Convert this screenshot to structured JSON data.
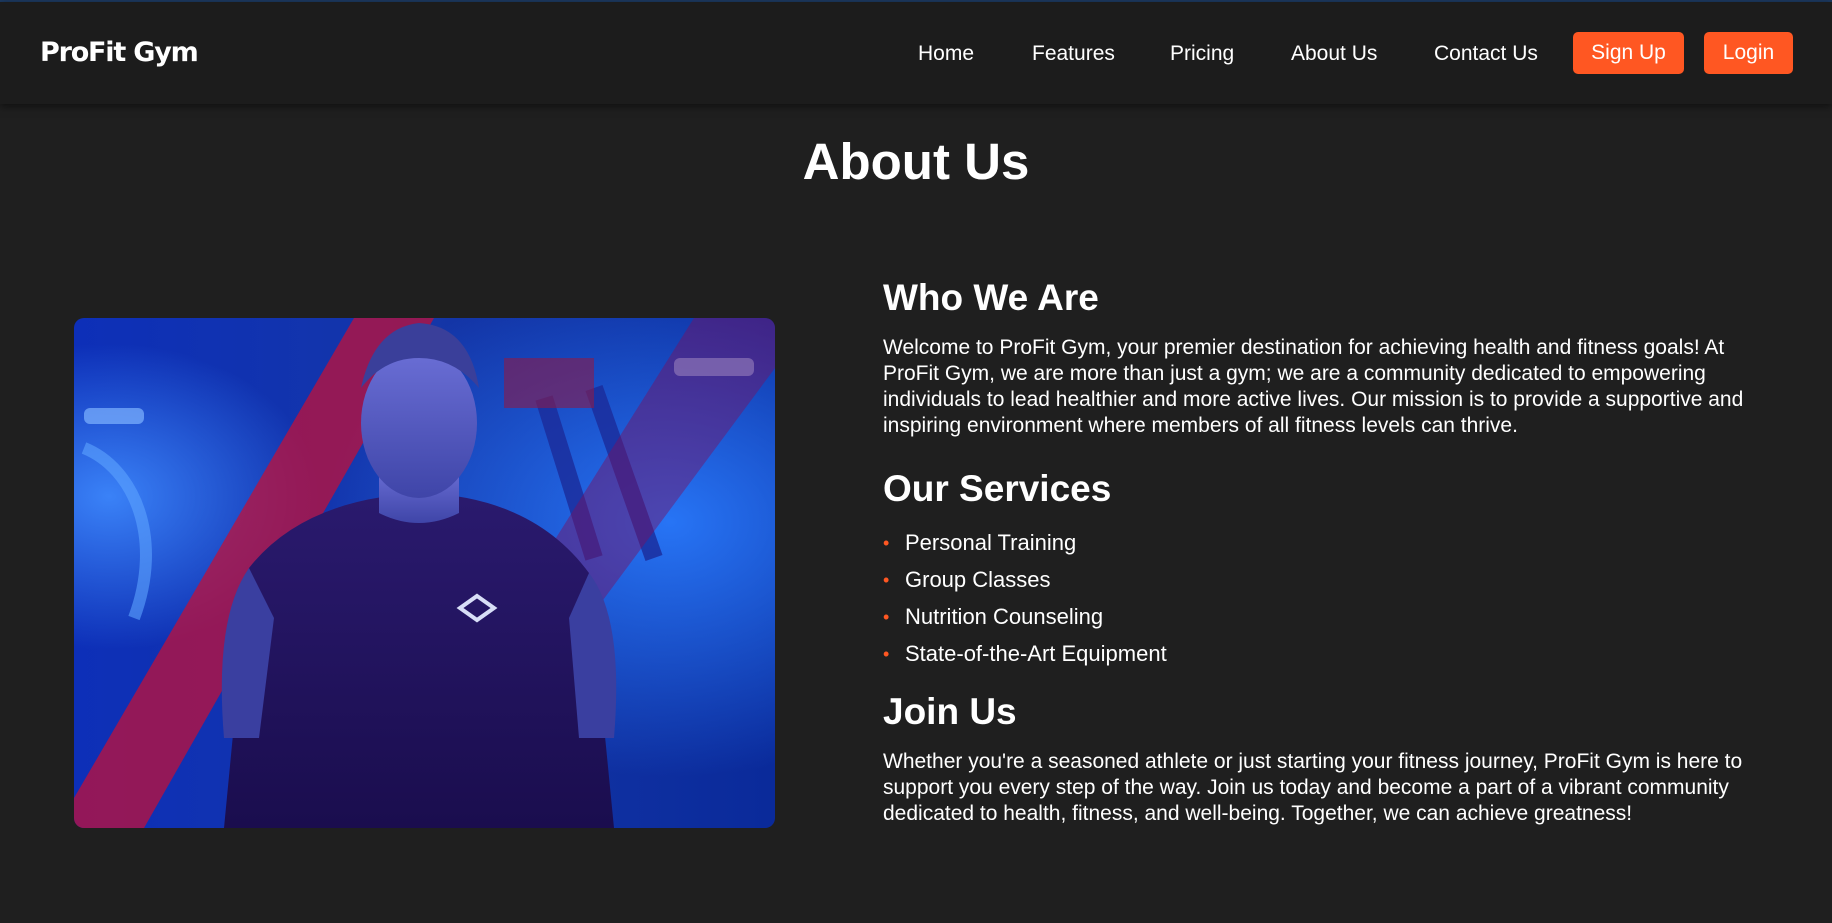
{
  "brand": {
    "name": "ProFit Gym",
    "accent_color": "#ff5722",
    "background_color": "#1f1f1f"
  },
  "nav": {
    "links": [
      "Home",
      "Features",
      "Pricing",
      "About Us",
      "Contact Us"
    ],
    "signup_label": "Sign Up",
    "login_label": "Login"
  },
  "page": {
    "title": "About Us"
  },
  "hero_image": {
    "subject": "man in dark t-shirt in a gym with blue and red diagonal tint"
  },
  "who": {
    "heading": "Who We Are",
    "text": "Welcome to ProFit Gym, your premier destination for achieving health and fitness goals! At ProFit Gym, we are more than just a gym; we are a community dedicated to empowering individuals to lead healthier and more active lives. Our mission is to provide a supportive and inspiring environment where members of all fitness levels can thrive."
  },
  "services": {
    "heading": "Our Services",
    "bullet_icon": "bullet-dot-icon",
    "items": [
      "Personal Training",
      "Group Classes",
      "Nutrition Counseling",
      "State-of-the-Art Equipment"
    ]
  },
  "join": {
    "heading": "Join Us",
    "text": "Whether you're a seasoned athlete or just starting your fitness journey, ProFit Gym is here to support you every step of the way. Join us today and become a part of a vibrant community dedicated to health, fitness, and well-being. Together, we can achieve greatness!"
  }
}
